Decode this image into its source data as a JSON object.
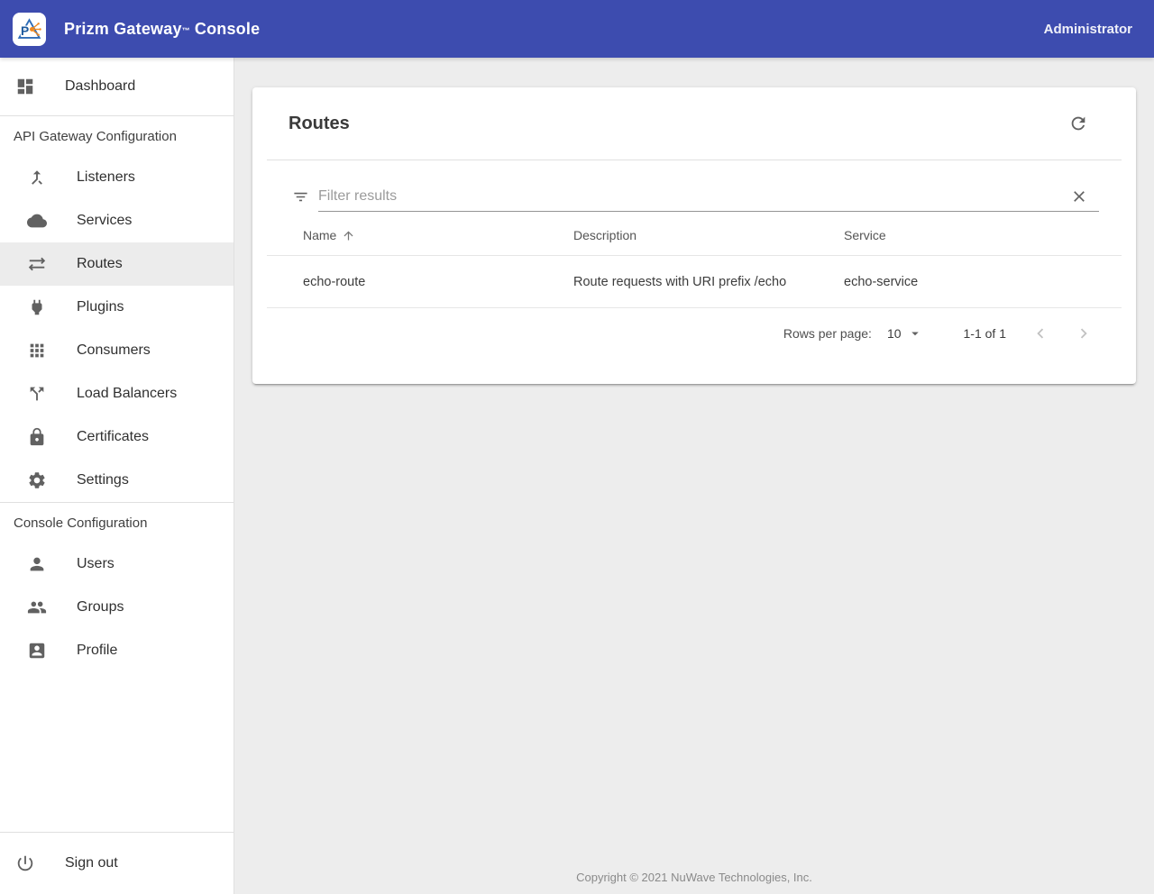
{
  "header": {
    "title_main": "Prizm Gateway",
    "title_tm": "™",
    "title_suffix": "Console",
    "user": "Administrator"
  },
  "sidebar": {
    "dashboard_label": "Dashboard",
    "section1": {
      "header": "API Gateway Configuration",
      "items": [
        {
          "label": "Listeners",
          "icon": "call-merge-icon"
        },
        {
          "label": "Services",
          "icon": "cloud-icon"
        },
        {
          "label": "Routes",
          "icon": "swap-arrows-icon",
          "selected": true
        },
        {
          "label": "Plugins",
          "icon": "power-plug-icon"
        },
        {
          "label": "Consumers",
          "icon": "apps-grid-icon"
        },
        {
          "label": "Load Balancers",
          "icon": "call-split-icon"
        },
        {
          "label": "Certificates",
          "icon": "lock-icon"
        },
        {
          "label": "Settings",
          "icon": "gear-icon"
        }
      ]
    },
    "section2": {
      "header": "Console Configuration",
      "items": [
        {
          "label": "Users",
          "icon": "person-icon"
        },
        {
          "label": "Groups",
          "icon": "people-icon"
        },
        {
          "label": "Profile",
          "icon": "account-box-icon"
        }
      ]
    },
    "sign_out_label": "Sign out",
    "selected_item": "Routes"
  },
  "card": {
    "title": "Routes",
    "filter": {
      "placeholder": "Filter results",
      "value": ""
    },
    "table": {
      "columns": [
        "Name",
        "Description",
        "Service"
      ],
      "sorted_by": "Name",
      "sort_direction": "ascending",
      "rows": [
        {
          "name": "echo-route",
          "description": "Route requests with URI prefix /echo",
          "service": "echo-service"
        }
      ]
    },
    "pagination": {
      "rows_per_page_label": "Rows per page:",
      "rows_per_page_value": "10",
      "range": "1-1 of 1"
    }
  },
  "footer": {
    "copyright": "Copyright © 2021 NuWave Technologies, Inc."
  },
  "colors": {
    "appbar": "#3d4caf",
    "content_bg": "#ededed",
    "selected_nav_bg": "#ececec",
    "icon_gray": "#616161",
    "logo_blue": "#1d5a9e",
    "logo_orange": "#f28a1e"
  }
}
